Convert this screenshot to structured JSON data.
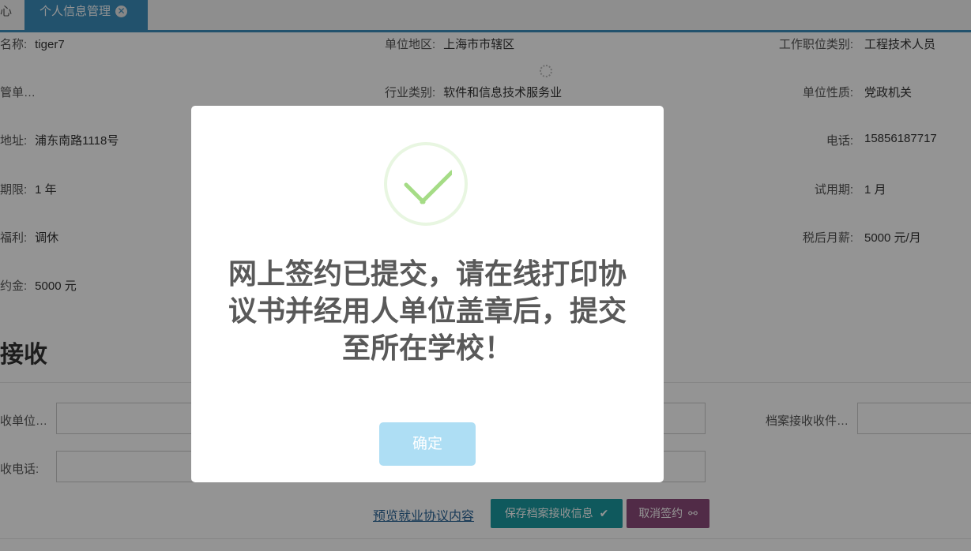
{
  "tabs": {
    "prev_label": "心",
    "active_label": "个人信息管理",
    "close_glyph": "✕"
  },
  "info": {
    "left": [
      {
        "label": "名称:",
        "value": "tiger7"
      },
      {
        "label": "管单…",
        "value": ""
      },
      {
        "label": "地址:",
        "value": "浦东南路1118号"
      },
      {
        "label": "期限:",
        "value": "1 年"
      },
      {
        "label": "福利:",
        "value": "调休"
      },
      {
        "label": "约金:",
        "value": "5000 元"
      }
    ],
    "middle": [
      {
        "label": "单位地区:",
        "value": "上海市市辖区"
      },
      {
        "label": "行业类别:",
        "value": "软件和信息技术服务业"
      }
    ],
    "right": [
      {
        "label": "工作职位类别:",
        "value": "工程技术人员"
      },
      {
        "label": "单位性质:",
        "value": "党政机关"
      },
      {
        "label": "电话:",
        "value": "15856187717"
      },
      {
        "label": "试用期:",
        "value": "1 月"
      },
      {
        "label": "税后月薪:",
        "value": "5000 元/月"
      }
    ]
  },
  "section": {
    "title": "接收",
    "labels": {
      "unit": "收单位…",
      "phone": "收电话:",
      "archive_receiver": "档案接收收件…"
    }
  },
  "actions": {
    "preview_link": "预览就业协议内容",
    "save_button": "保存档案接收信息",
    "cancel_button": "取消签约"
  },
  "modal": {
    "message_line1": "网上签约已提交，请在线打印协",
    "message_line2": "议书并经用人单位盖章后，提交",
    "message_line3": "至所在学校！",
    "confirm_label": "确定"
  },
  "colors": {
    "tab_active": "#3c8dbc",
    "teal_button": "#1a9aa0",
    "purple_button": "#8c4a7a",
    "confirm_button": "#aedef4",
    "success_check": "#a5dc86"
  }
}
